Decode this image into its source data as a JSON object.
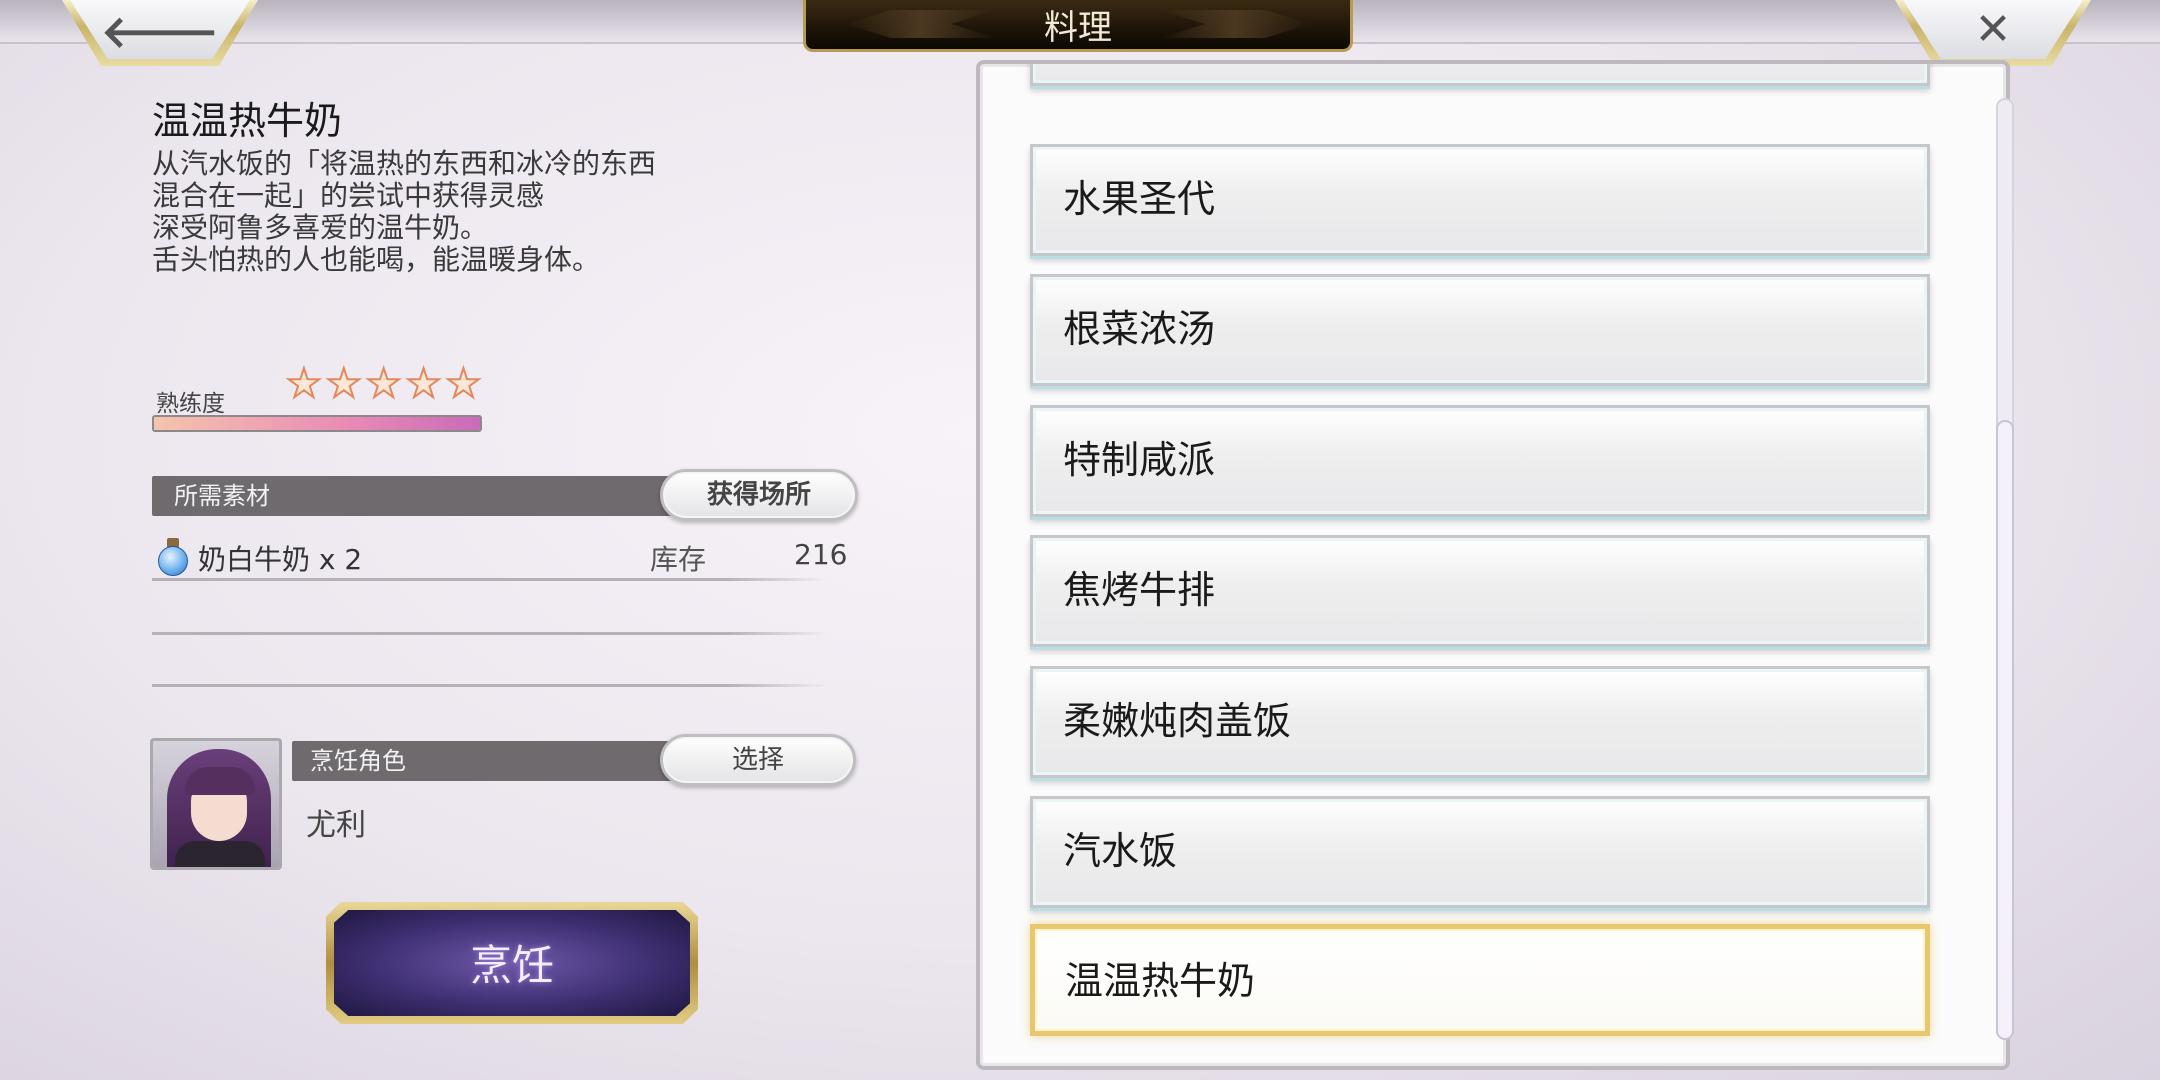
{
  "header": {
    "title": "料理",
    "back_icon": "arrow-left-icon",
    "close_icon": "close-x-icon"
  },
  "dish": {
    "name": "温温热牛奶",
    "description": [
      "从汽水饭的「将温热的东西和冰冷的东西",
      "混合在一起」的尝试中获得灵感",
      "深受阿鲁多喜爱的温牛奶。",
      "舌头怕热的人也能喝，能温暖身体。"
    ]
  },
  "proficiency": {
    "label": "熟练度",
    "stars_total": 5,
    "stars_filled": 0,
    "progress": 1.0
  },
  "materials": {
    "header": "所需素材",
    "obtain_button": "获得场所",
    "items": [
      {
        "icon": "milk-potion-icon",
        "name": "奶白牛奶 x 2",
        "stock_label": "库存",
        "stock": "216"
      }
    ]
  },
  "cook_role": {
    "header": "烹饪角色",
    "select_button": "选择",
    "character_name": "尤利"
  },
  "cook_button": "烹饪",
  "recipe_list": [
    "水果圣代",
    "根菜浓汤",
    "特制咸派",
    "焦烤牛排",
    "柔嫩炖肉盖饭",
    "汽水饭",
    "温温热牛奶"
  ],
  "selected_recipe_index": 6,
  "colors": {
    "accent_gold": "#e7c86f",
    "section_gray": "#6e6a6e",
    "cook_purple": "#3f2f73"
  }
}
